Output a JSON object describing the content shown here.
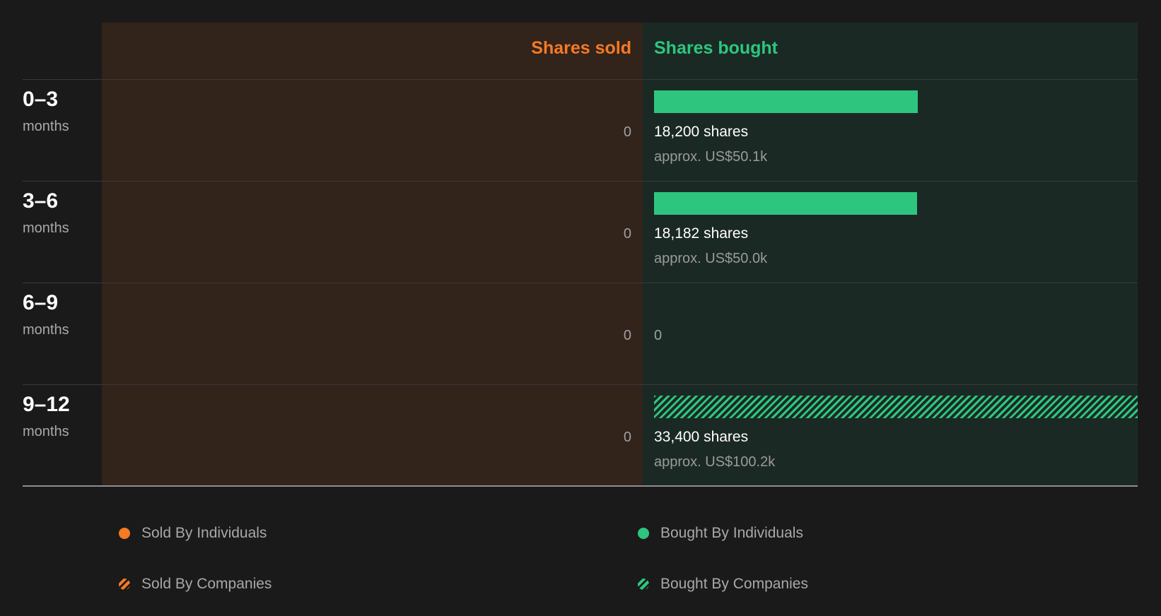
{
  "chart_data": {
    "type": "bar",
    "column_headers": {
      "sold": "Shares sold",
      "bought": "Shares bought"
    },
    "categories": [
      "0-3 months",
      "3-6 months",
      "6-9 months",
      "9-12 months"
    ],
    "rows": [
      {
        "range": "0–3",
        "unit": "months",
        "sold_label": "0",
        "sold_shares": 0,
        "bought_shares": 18200,
        "bought_label": "18,200 shares",
        "bought_value_label": "approx. US$50.1k",
        "bought_by": "individuals"
      },
      {
        "range": "3–6",
        "unit": "months",
        "sold_label": "0",
        "sold_shares": 0,
        "bought_shares": 18182,
        "bought_label": "18,182 shares",
        "bought_value_label": "approx. US$50.0k",
        "bought_by": "individuals"
      },
      {
        "range": "6–9",
        "unit": "months",
        "sold_label": "0",
        "sold_shares": 0,
        "bought_shares": 0,
        "bought_label": "0",
        "bought_value_label": "",
        "bought_by": "none"
      },
      {
        "range": "9–12",
        "unit": "months",
        "sold_label": "0",
        "sold_shares": 0,
        "bought_shares": 33400,
        "bought_label": "33,400 shares",
        "bought_value_label": "approx. US$100.2k",
        "bought_by": "companies"
      }
    ],
    "bought_axis_max": 33400,
    "legend": [
      {
        "label": "Sold By Individuals",
        "color": "#f47a24",
        "pattern": "solid"
      },
      {
        "label": "Bought By Individuals",
        "color": "#2ec67e",
        "pattern": "solid"
      },
      {
        "label": "Sold By Companies",
        "color": "#f47a24",
        "pattern": "hatched"
      },
      {
        "label": "Bought By Companies",
        "color": "#2ec67e",
        "pattern": "hatched"
      }
    ],
    "legend_placement": "bottom",
    "colors": {
      "sold": "#f47a24",
      "bought": "#2ec67e"
    }
  }
}
